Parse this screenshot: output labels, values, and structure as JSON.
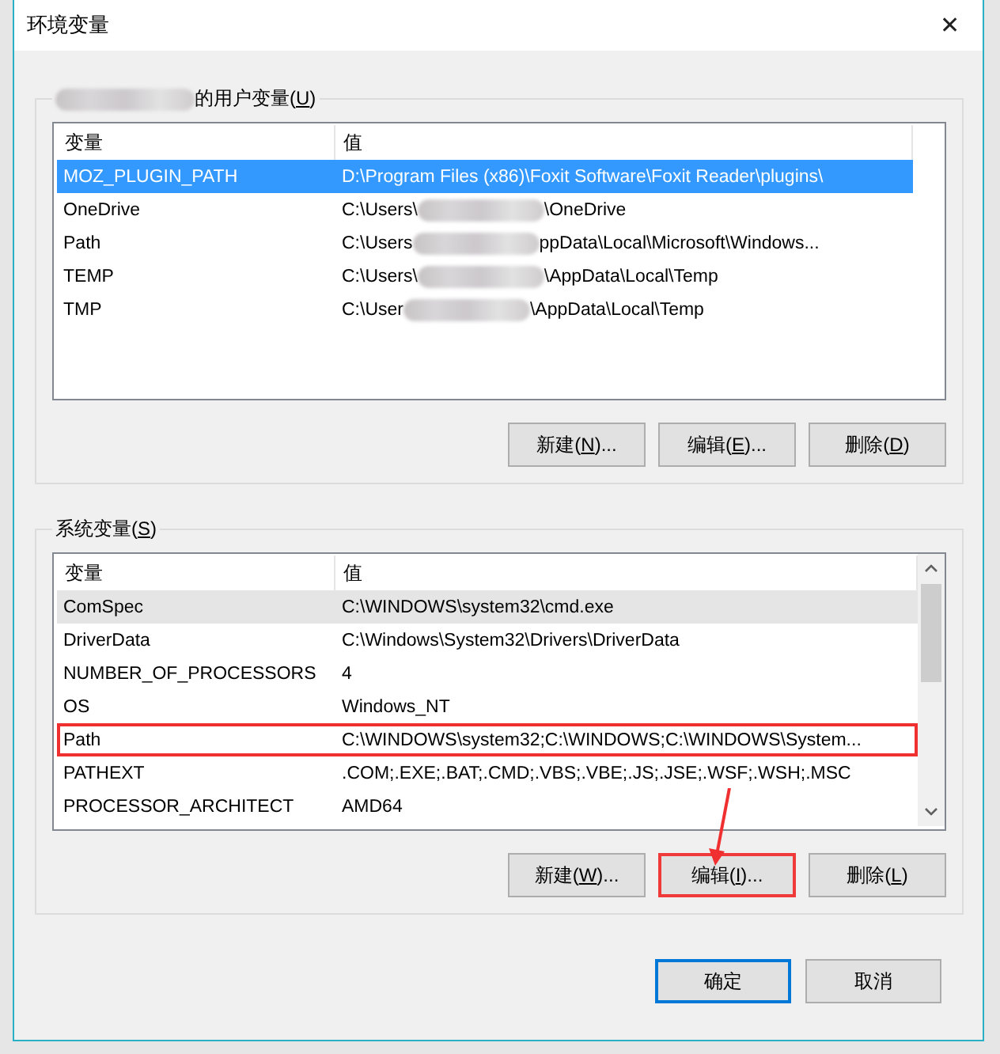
{
  "window": {
    "title": "环境变量",
    "close": "✕"
  },
  "user_variables": {
    "heading_parts": [
      "的用户变量(",
      "U",
      ")"
    ],
    "heading_redacted": true,
    "columns": [
      "变量",
      "值"
    ],
    "rows": [
      {
        "name": "MOZ_PLUGIN_PATH",
        "value_start": "D:\\Program Files (x86)\\Foxit Software\\Foxit Reader\\plugins\\",
        "value_end": "",
        "redacted": false,
        "selected": true
      },
      {
        "name": "OneDrive",
        "value_start": "C:\\Users\\",
        "value_end": "\\OneDrive",
        "redacted": true,
        "selected": false
      },
      {
        "name": "Path",
        "value_start": "C:\\Users",
        "value_end": "ppData\\Local\\Microsoft\\Windows...",
        "redacted": true,
        "selected": false
      },
      {
        "name": "TEMP",
        "value_start": "C:\\Users\\",
        "value_end": "\\AppData\\Local\\Temp",
        "redacted": true,
        "selected": false
      },
      {
        "name": "TMP",
        "value_start": "C:\\User",
        "value_end": "\\AppData\\Local\\Temp",
        "redacted": true,
        "selected": false
      }
    ],
    "buttons": [
      {
        "label_parts": [
          "新建(",
          "N",
          ")..."
        ],
        "highlighted": false
      },
      {
        "label_parts": [
          "编辑(",
          "E",
          ")..."
        ],
        "highlighted": false
      },
      {
        "label_parts": [
          "删除(",
          "D",
          ")"
        ],
        "highlighted": false
      }
    ]
  },
  "system_variables": {
    "heading_parts": [
      "系统变量(",
      "S",
      ")"
    ],
    "heading_redacted": false,
    "columns": [
      "变量",
      "值"
    ],
    "rows": [
      {
        "name": "ComSpec",
        "value_start": "C:\\WINDOWS\\system32\\cmd.exe",
        "value_end": "",
        "redacted": false,
        "selected": true,
        "highlighted": false
      },
      {
        "name": "DriverData",
        "value_start": "C:\\Windows\\System32\\Drivers\\DriverData",
        "value_end": "",
        "redacted": false,
        "selected": false,
        "highlighted": false
      },
      {
        "name": "NUMBER_OF_PROCESSORS",
        "value_start": "4",
        "value_end": "",
        "redacted": false,
        "selected": false,
        "highlighted": false
      },
      {
        "name": "OS",
        "value_start": "Windows_NT",
        "value_end": "",
        "redacted": false,
        "selected": false,
        "highlighted": false
      },
      {
        "name": "Path",
        "value_start": "C:\\WINDOWS\\system32;C:\\WINDOWS;C:\\WINDOWS\\System...",
        "value_end": "",
        "redacted": false,
        "selected": false,
        "highlighted": true
      },
      {
        "name": "PATHEXT",
        "value_start": ".COM;.EXE;.BAT;.CMD;.VBS;.VBE;.JS;.JSE;.WSF;.WSH;.MSC",
        "value_end": "",
        "redacted": false,
        "selected": false,
        "highlighted": false
      },
      {
        "name": "PROCESSOR_ARCHITECT",
        "value_start": "AMD64",
        "value_end": "",
        "redacted": false,
        "selected": false,
        "highlighted": false
      }
    ],
    "buttons": [
      {
        "label_parts": [
          "新建(",
          "W",
          ")..."
        ],
        "highlighted": false
      },
      {
        "label_parts": [
          "编辑(",
          "I",
          ")..."
        ],
        "highlighted": true
      },
      {
        "label_parts": [
          "删除(",
          "L",
          ")"
        ],
        "highlighted": false
      }
    ]
  },
  "footer_buttons": [
    {
      "label": "确定",
      "default": true
    },
    {
      "label": "取消",
      "default": false
    }
  ]
}
